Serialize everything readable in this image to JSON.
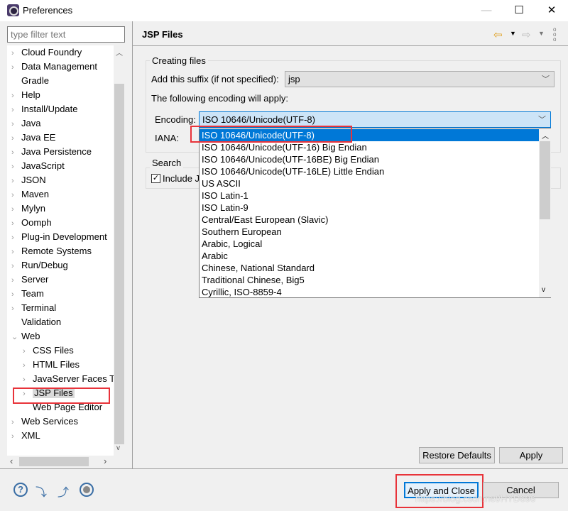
{
  "window": {
    "title": "Preferences",
    "minimize": "—",
    "maximize": "☐",
    "close": "✕"
  },
  "sidebar": {
    "filter_placeholder": "type filter text",
    "items": [
      {
        "label": "Cloud Foundry",
        "expander": ">",
        "level": 0
      },
      {
        "label": "Data Management",
        "expander": ">",
        "level": 0
      },
      {
        "label": "Gradle",
        "expander": "",
        "level": 0
      },
      {
        "label": "Help",
        "expander": ">",
        "level": 0
      },
      {
        "label": "Install/Update",
        "expander": ">",
        "level": 0
      },
      {
        "label": "Java",
        "expander": ">",
        "level": 0
      },
      {
        "label": "Java EE",
        "expander": ">",
        "level": 0
      },
      {
        "label": "Java Persistence",
        "expander": ">",
        "level": 0
      },
      {
        "label": "JavaScript",
        "expander": ">",
        "level": 0
      },
      {
        "label": "JSON",
        "expander": ">",
        "level": 0
      },
      {
        "label": "Maven",
        "expander": ">",
        "level": 0
      },
      {
        "label": "Mylyn",
        "expander": ">",
        "level": 0
      },
      {
        "label": "Oomph",
        "expander": ">",
        "level": 0
      },
      {
        "label": "Plug-in Development",
        "expander": ">",
        "level": 0
      },
      {
        "label": "Remote Systems",
        "expander": ">",
        "level": 0
      },
      {
        "label": "Run/Debug",
        "expander": ">",
        "level": 0
      },
      {
        "label": "Server",
        "expander": ">",
        "level": 0
      },
      {
        "label": "Team",
        "expander": ">",
        "level": 0
      },
      {
        "label": "Terminal",
        "expander": ">",
        "level": 0
      },
      {
        "label": "Validation",
        "expander": "",
        "level": 0
      },
      {
        "label": "Web",
        "expander": "v",
        "level": 0
      },
      {
        "label": "CSS Files",
        "expander": ">",
        "level": 1
      },
      {
        "label": "HTML Files",
        "expander": ">",
        "level": 1
      },
      {
        "label": "JavaServer Faces Tools",
        "expander": ">",
        "level": 1
      },
      {
        "label": "JSP Files",
        "expander": ">",
        "level": 1,
        "selected": true
      },
      {
        "label": "Web Page Editor",
        "expander": "",
        "level": 1
      },
      {
        "label": "Web Services",
        "expander": ">",
        "level": 0
      },
      {
        "label": "XML",
        "expander": ">",
        "level": 0
      }
    ]
  },
  "main": {
    "title": "JSP Files",
    "creating_files": {
      "group_label": "Creating files",
      "suffix_label": "Add this suffix (if not specified):",
      "suffix_value": "jsp",
      "encoding_note": "The following encoding will apply:",
      "encoding_label": "Encoding:",
      "encoding_value": "ISO 10646/Unicode(UTF-8)",
      "iana_label": "IANA:"
    },
    "search": {
      "group_label": "Search",
      "include_label": "Include J",
      "include_checked": true
    },
    "encoding_options": [
      "ISO 10646/Unicode(UTF-8)",
      "ISO 10646/Unicode(UTF-16) Big Endian",
      "ISO 10646/Unicode(UTF-16BE) Big Endian",
      "ISO 10646/Unicode(UTF-16LE) Little Endian",
      "US ASCII",
      "ISO Latin-1",
      "ISO Latin-9",
      "Central/East European (Slavic)",
      "Southern European",
      "Arabic, Logical",
      "Arabic",
      "Chinese, National Standard",
      "Traditional Chinese, Big5",
      "Cyrillic, ISO-8859-4"
    ],
    "restore_defaults": "Restore Defaults",
    "apply": "Apply"
  },
  "footer": {
    "apply_close": "Apply and Close",
    "cancel": "Cancel"
  },
  "watermark": "https://blog.csdn.net/HYD696",
  "colors": {
    "selection": "#0078d7",
    "highlight_box": "#e8333a"
  }
}
